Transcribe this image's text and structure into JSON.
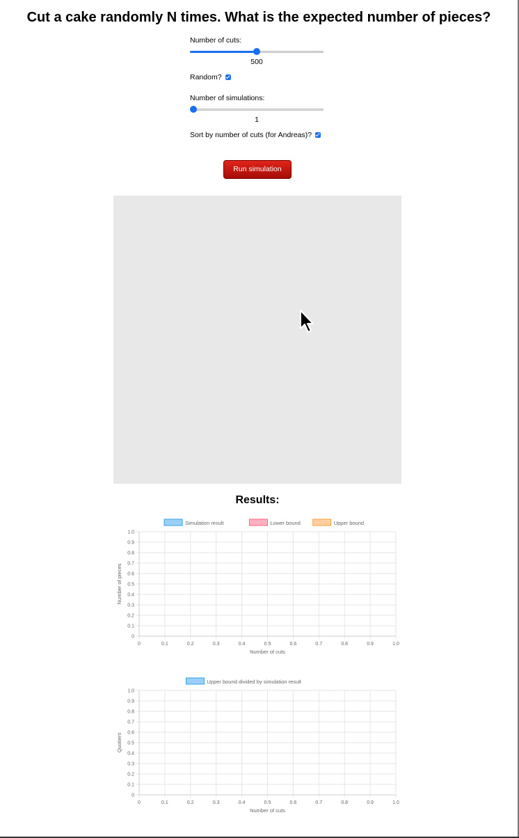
{
  "title": "Cut a cake randomly N times. What is the expected number of pieces?",
  "controls": {
    "cuts_label": "Number of cuts:",
    "cuts_value": "500",
    "cuts_fraction": 0.5,
    "random_label": "Random?",
    "random_checked": true,
    "sims_label": "Number of simulations:",
    "sims_value": "1",
    "sims_fraction": 0.0,
    "sort_label": "Sort by number of cuts (for Andreas)?",
    "sort_checked": true,
    "run_label": "Run simulation"
  },
  "results_title": "Results:",
  "chart_data": [
    {
      "type": "line",
      "series": [
        {
          "name": "Simulation result",
          "values": [],
          "color": "#36a2eb"
        },
        {
          "name": "Lower bound",
          "values": [],
          "color": "#ff6384"
        },
        {
          "name": "Upper bound",
          "values": [],
          "color": "#ff9f40"
        }
      ],
      "xlabel": "Number of cuts",
      "ylabel": "Number of pieces",
      "xlim": [
        0,
        1.0
      ],
      "ylim": [
        0,
        1.0
      ],
      "x_ticks": [
        "0",
        "0.1",
        "0.2",
        "0.3",
        "0.4",
        "0.5",
        "0.6",
        "0.7",
        "0.8",
        "0.9",
        "1.0"
      ],
      "y_ticks": [
        "0",
        "0.1",
        "0.2",
        "0.3",
        "0.4",
        "0.5",
        "0.6",
        "0.7",
        "0.8",
        "0.9",
        "1.0"
      ],
      "grid": true,
      "legend": "top"
    },
    {
      "type": "line",
      "series": [
        {
          "name": "Upper bound divided by simulation result",
          "values": [],
          "color": "#36a2eb"
        }
      ],
      "xlabel": "Number of cuts",
      "ylabel": "Quotient",
      "xlim": [
        0,
        1.0
      ],
      "ylim": [
        0,
        1.0
      ],
      "x_ticks": [
        "0",
        "0.1",
        "0.2",
        "0.3",
        "0.4",
        "0.5",
        "0.6",
        "0.7",
        "0.8",
        "0.9",
        "1.0"
      ],
      "y_ticks": [
        "0",
        "0.1",
        "0.2",
        "0.3",
        "0.4",
        "0.5",
        "0.6",
        "0.7",
        "0.8",
        "0.9",
        "1.0"
      ],
      "grid": true,
      "legend": "top"
    }
  ]
}
